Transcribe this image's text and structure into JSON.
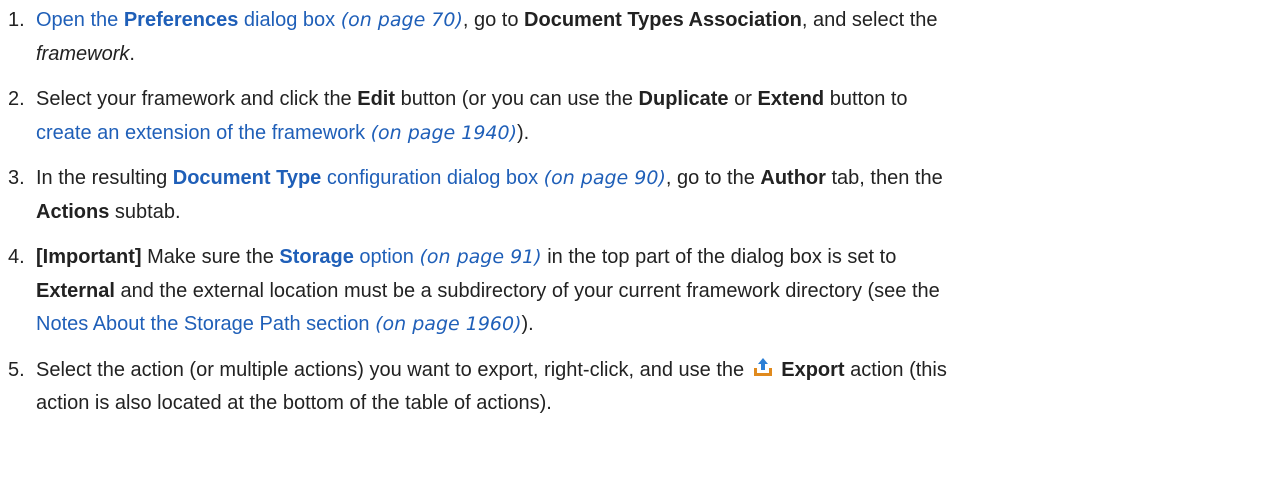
{
  "steps": [
    {
      "num": "1.",
      "parts": [
        {
          "t": "link",
          "v": "Open the "
        },
        {
          "t": "linkbold",
          "v": "Preferences"
        },
        {
          "t": "link",
          "v": " dialog box"
        },
        {
          "t": "text",
          "v": "  "
        },
        {
          "t": "ref",
          "v": "(on page 70)"
        },
        {
          "t": "text",
          "v": ", go to "
        },
        {
          "t": "bold",
          "v": "Document Types Association"
        },
        {
          "t": "text",
          "v": ", and select the "
        },
        {
          "t": "br"
        },
        {
          "t": "italic",
          "v": "framework"
        },
        {
          "t": "text",
          "v": "."
        }
      ]
    },
    {
      "num": "2.",
      "parts": [
        {
          "t": "text",
          "v": "Select your framework and click the "
        },
        {
          "t": "bold",
          "v": "Edit"
        },
        {
          "t": "text",
          "v": " button (or you can use the "
        },
        {
          "t": "bold",
          "v": "Duplicate"
        },
        {
          "t": "text",
          "v": " or "
        },
        {
          "t": "bold",
          "v": "Extend"
        },
        {
          "t": "text",
          "v": " button to "
        },
        {
          "t": "br"
        },
        {
          "t": "link",
          "v": "create an extension of the framework "
        },
        {
          "t": "ref",
          "v": "(on page 1940)"
        },
        {
          "t": "text",
          "v": ")."
        }
      ]
    },
    {
      "num": "3.",
      "parts": [
        {
          "t": "text",
          "v": "In the resulting "
        },
        {
          "t": "linkbold",
          "v": "Document Type"
        },
        {
          "t": "link",
          "v": " configuration dialog box "
        },
        {
          "t": "ref",
          "v": "(on page 90)"
        },
        {
          "t": "text",
          "v": ", go to the "
        },
        {
          "t": "bold",
          "v": "Author"
        },
        {
          "t": "text",
          "v": " tab, then the "
        },
        {
          "t": "br"
        },
        {
          "t": "bold",
          "v": "Actions"
        },
        {
          "t": "text",
          "v": " subtab."
        }
      ]
    },
    {
      "num": "4.",
      "parts": [
        {
          "t": "bold",
          "v": "[Important]"
        },
        {
          "t": "text",
          "v": " Make sure the "
        },
        {
          "t": "linkbold",
          "v": "Storage"
        },
        {
          "t": "link",
          "v": " option "
        },
        {
          "t": "ref",
          "v": "(on page 91)"
        },
        {
          "t": "text",
          "v": " in the top part of the dialog box is set to "
        },
        {
          "t": "br"
        },
        {
          "t": "bold",
          "v": "External"
        },
        {
          "t": "text",
          "v": " and the external location must be a subdirectory of your current framework directory (see the "
        },
        {
          "t": "br"
        },
        {
          "t": "link",
          "v": "Notes About the Storage Path section "
        },
        {
          "t": "ref",
          "v": "(on page 1960)"
        },
        {
          "t": "text",
          "v": ")."
        }
      ]
    },
    {
      "num": "5.",
      "parts": [
        {
          "t": "text",
          "v": "Select the action (or multiple actions) you want to export, right-click, and use the "
        },
        {
          "t": "icon",
          "v": "export-icon"
        },
        {
          "t": "text",
          "v": " "
        },
        {
          "t": "bold",
          "v": "Export"
        },
        {
          "t": "text",
          "v": " action (this "
        },
        {
          "t": "br"
        },
        {
          "t": "text",
          "v": "action is also located at the bottom of the table of actions)."
        }
      ]
    }
  ],
  "colors": {
    "link": "#1f5fb8",
    "text": "#222222",
    "icon_arrow": "#2b7fd6",
    "icon_tray": "#e08a1e"
  }
}
